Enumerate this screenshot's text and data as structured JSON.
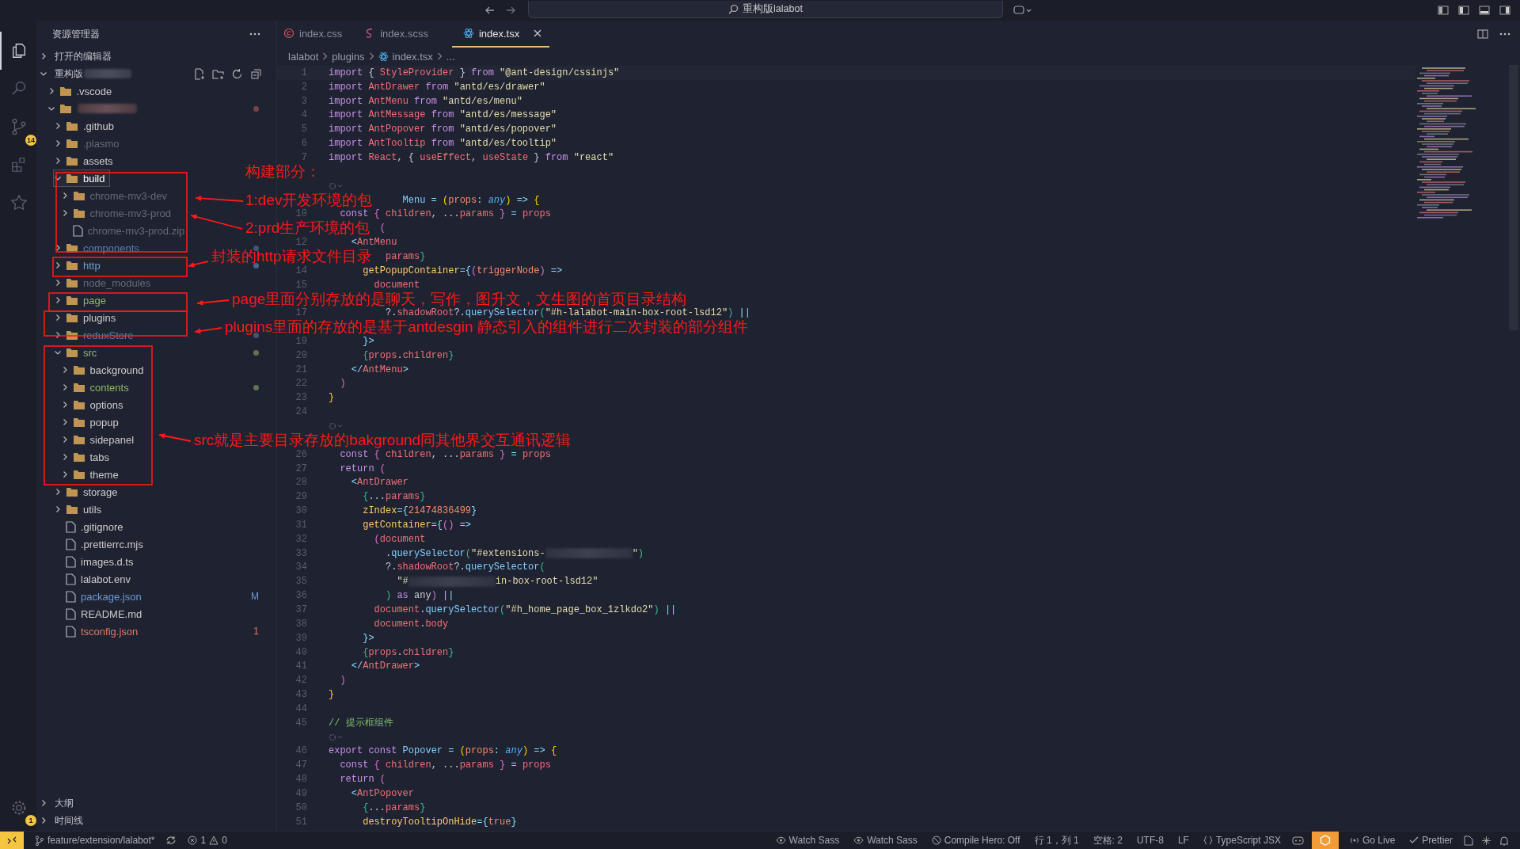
{
  "title_bar": {
    "search": "重构版lalabot"
  },
  "activity_bar": {
    "items": [
      {
        "kind": "explorer",
        "selected": true
      },
      {
        "kind": "search",
        "selected": false
      },
      {
        "kind": "scm",
        "selected": false,
        "badge": "14"
      },
      {
        "kind": "extensions",
        "selected": false
      },
      {
        "kind": "star",
        "selected": false
      }
    ],
    "account_badge": "1"
  },
  "explorer": {
    "title": "资源管理器",
    "sections": [
      {
        "label": "打开的编辑器",
        "expanded": false
      },
      {
        "label": "重构版",
        "redacted_suffix": true,
        "expanded": true,
        "items": [
          {
            "name": ".vscode",
            "kind": "folder",
            "expanded": false,
            "selected": false,
            "color": "#cccccc"
          },
          {
            "kind": "folder",
            "redacted": true,
            "expanded": true,
            "selected": false,
            "dot": true,
            "children": [
              {
                "name": ".github",
                "kind": "folder",
                "expanded": false,
                "selected": false,
                "color": "#cccccc"
              },
              {
                "name": ".plasmo",
                "kind": "folder",
                "expanded": false,
                "selected": false,
                "color": "#666b75"
              },
              {
                "name": "assets",
                "kind": "folder",
                "expanded": false,
                "selected": false,
                "color": "#cccccc"
              },
              {
                "name": "build",
                "kind": "folder",
                "expanded": true,
                "selected": true,
                "color": "#ffffff",
                "children": [
                  {
                    "name": "chrome-mv3-dev",
                    "kind": "folder",
                    "expanded": false,
                    "selected": false,
                    "color": "#666b75"
                  },
                  {
                    "name": "chrome-mv3-prod",
                    "kind": "folder",
                    "expanded": false,
                    "selected": false,
                    "color": "#666b75"
                  },
                  {
                    "name": "chrome-mv3-prod.zip",
                    "kind": "file",
                    "selected": false,
                    "color": "#666b75"
                  }
                ]
              },
              {
                "name": "components",
                "kind": "folder",
                "expanded": false,
                "selected": false,
                "color": "#5b7fae",
                "dot": true
              },
              {
                "name": "http",
                "kind": "folder",
                "expanded": false,
                "selected": false,
                "color": "#6c9bd2",
                "dot": true
              },
              {
                "name": "node_modules",
                "kind": "folder",
                "expanded": false,
                "selected": false,
                "color": "#666b75"
              },
              {
                "name": "page",
                "kind": "folder",
                "expanded": false,
                "selected": false,
                "color": "#8fb96b"
              },
              {
                "name": "plugins",
                "kind": "folder",
                "expanded": false,
                "selected": false,
                "color": "#cccccc"
              },
              {
                "name": "reduxStore",
                "kind": "folder",
                "expanded": false,
                "selected": false,
                "color": "#5b7fae",
                "dot": true
              },
              {
                "name": "src",
                "kind": "folder",
                "expanded": true,
                "selected": false,
                "color": "#8fb96b",
                "dot": true,
                "children": [
                  {
                    "name": "background",
                    "kind": "folder",
                    "expanded": false,
                    "selected": false,
                    "color": "#cccccc"
                  },
                  {
                    "name": "contents",
                    "kind": "folder",
                    "expanded": false,
                    "selected": false,
                    "color": "#8fb96b",
                    "dot": true
                  },
                  {
                    "name": "options",
                    "kind": "folder",
                    "expanded": false,
                    "selected": false,
                    "color": "#cccccc"
                  },
                  {
                    "name": "popup",
                    "kind": "folder",
                    "expanded": false,
                    "selected": false,
                    "color": "#cccccc"
                  },
                  {
                    "name": "sidepanel",
                    "kind": "folder",
                    "expanded": false,
                    "selected": false,
                    "color": "#cccccc"
                  },
                  {
                    "name": "tabs",
                    "kind": "folder",
                    "expanded": false,
                    "selected": false,
                    "color": "#cccccc"
                  },
                  {
                    "name": "theme",
                    "kind": "folder",
                    "expanded": false,
                    "selected": false,
                    "color": "#cccccc"
                  }
                ]
              },
              {
                "name": "storage",
                "kind": "folder",
                "expanded": false,
                "selected": false,
                "color": "#cccccc"
              },
              {
                "name": "utils",
                "kind": "folder",
                "expanded": false,
                "selected": false,
                "color": "#cccccc"
              },
              {
                "name": ".gitignore",
                "kind": "file",
                "selected": false,
                "color": "#cccccc"
              },
              {
                "name": ".prettierrc.mjs",
                "kind": "file",
                "selected": false,
                "color": "#cccccc"
              },
              {
                "name": "images.d.ts",
                "kind": "file",
                "selected": false,
                "color": "#cccccc"
              },
              {
                "name": "lalabot.env",
                "kind": "file",
                "selected": false,
                "color": "#cccccc"
              },
              {
                "name": "package.json",
                "kind": "file",
                "selected": false,
                "color": "#6c9bd2",
                "badge": "M"
              },
              {
                "name": "README.md",
                "kind": "file",
                "selected": false,
                "color": "#cccccc"
              },
              {
                "name": "tsconfig.json",
                "kind": "file",
                "selected": false,
                "color": "#e2786a",
                "badge": "1"
              }
            ]
          }
        ]
      }
    ],
    "bottom_sections": [
      {
        "label": "大纲",
        "expanded": false
      },
      {
        "label": "时间线",
        "expanded": false
      }
    ]
  },
  "tabs": [
    {
      "label": "index.css",
      "kind": "css",
      "selected": false
    },
    {
      "label": "index.scss",
      "kind": "scss",
      "selected": false
    },
    {
      "label": "index.tsx",
      "kind": "tsx",
      "selected": true
    }
  ],
  "breadcrumb": [
    {
      "label": "lalabot",
      "kind": "folder"
    },
    {
      "label": "plugins",
      "kind": "folder"
    },
    {
      "label": "index.tsx",
      "kind": "tsx"
    },
    {
      "label": "...",
      "kind": "more"
    }
  ],
  "code": [
    {
      "number": "1",
      "tokens": [
        {
          "text": "import",
          "kind": "keyword"
        },
        {
          "text": " { ",
          "kind": "plain"
        },
        {
          "text": "StyleProvider",
          "kind": "name"
        },
        {
          "text": " } ",
          "kind": "plain"
        },
        {
          "text": "from",
          "kind": "keyword"
        },
        {
          "text": " \"@ant-design/cssinjs\"",
          "kind": "string"
        }
      ]
    },
    {
      "number": "2",
      "tokens": [
        {
          "text": "import",
          "kind": "keyword"
        },
        {
          "text": " AntDrawer ",
          "kind": "name"
        },
        {
          "text": "from",
          "kind": "keyword"
        },
        {
          "text": " \"antd/es/drawer\"",
          "kind": "string"
        }
      ]
    },
    {
      "number": "3",
      "tokens": [
        {
          "text": "import",
          "kind": "keyword"
        },
        {
          "text": " AntMenu ",
          "kind": "name"
        },
        {
          "text": "from",
          "kind": "keyword"
        },
        {
          "text": " \"antd/es/menu\"",
          "kind": "string"
        }
      ]
    },
    {
      "number": "4",
      "tokens": [
        {
          "text": "import",
          "kind": "keyword"
        },
        {
          "text": " AntMessage ",
          "kind": "name"
        },
        {
          "text": "from",
          "kind": "keyword"
        },
        {
          "text": " \"antd/es/message\"",
          "kind": "string"
        }
      ]
    },
    {
      "number": "5",
      "tokens": [
        {
          "text": "import",
          "kind": "keyword"
        },
        {
          "text": " AntPopover ",
          "kind": "name"
        },
        {
          "text": "from",
          "kind": "keyword"
        },
        {
          "text": " \"antd/es/popover\"",
          "kind": "string"
        }
      ]
    },
    {
      "number": "6",
      "tokens": [
        {
          "text": "import",
          "kind": "keyword"
        },
        {
          "text": " AntTooltip ",
          "kind": "name"
        },
        {
          "text": "from",
          "kind": "keyword"
        },
        {
          "text": " \"antd/es/tooltip\"",
          "kind": "string"
        }
      ]
    },
    {
      "number": "7",
      "tokens": [
        {
          "text": "import",
          "kind": "keyword"
        },
        {
          "text": " React",
          "kind": "name"
        },
        {
          "text": ", { ",
          "kind": "plain"
        },
        {
          "text": "useEffect",
          "kind": "name"
        },
        {
          "text": ", ",
          "kind": "plain"
        },
        {
          "text": "useState",
          "kind": "name"
        },
        {
          "text": " } ",
          "kind": "plain"
        },
        {
          "text": "from",
          "kind": "keyword"
        },
        {
          "text": " \"react\"",
          "kind": "string"
        }
      ]
    },
    {
      "kind": "blank"
    },
    {
      "kind": "codelens"
    },
    {
      "tokens": [
        {
          "text": "             Menu",
          "kind": "function"
        },
        {
          "text": " = ",
          "kind": "operator"
        },
        {
          "text": "(",
          "kind": "bracket1"
        },
        {
          "text": "props",
          "kind": "param"
        },
        {
          "text": ": ",
          "kind": "operator"
        },
        {
          "text": "any",
          "kind": "type"
        },
        {
          "text": ")",
          "kind": "bracket1"
        },
        {
          "text": " => ",
          "kind": "operator"
        },
        {
          "text": "{",
          "kind": "bracket1"
        }
      ]
    },
    {
      "number": "10",
      "tokens": [
        {
          "text": "  const",
          "kind": "keyword"
        },
        {
          "text": " { ",
          "kind": "bracket2"
        },
        {
          "text": "children",
          "kind": "variable"
        },
        {
          "text": ", ...",
          "kind": "plain"
        },
        {
          "text": "params",
          "kind": "variable"
        },
        {
          "text": " }",
          "kind": "bracket2"
        },
        {
          "text": " = ",
          "kind": "operator"
        },
        {
          "text": "props",
          "kind": "variable"
        }
      ]
    },
    {
      "tokens": [
        {
          "text": "         (",
          "kind": "bracket2"
        }
      ]
    },
    {
      "number": "12",
      "tokens": [
        {
          "text": "    <",
          "kind": "operator"
        },
        {
          "text": "AntMenu",
          "kind": "name"
        }
      ]
    },
    {
      "tokens": [
        {
          "text": "          params",
          "kind": "variable"
        },
        {
          "text": "}",
          "kind": "bracket3"
        }
      ]
    },
    {
      "number": "14",
      "tokens": [
        {
          "text": "      getPopupContainer",
          "kind": "attribute"
        },
        {
          "text": "={",
          "kind": "operator"
        },
        {
          "text": "(",
          "kind": "bracket2"
        },
        {
          "text": "triggerNode",
          "kind": "param"
        },
        {
          "text": ")",
          "kind": "bracket2"
        },
        {
          "text": " =>",
          "kind": "operator"
        }
      ]
    },
    {
      "number": "15",
      "tokens": [
        {
          "text": "        document",
          "kind": "variable"
        }
      ]
    },
    {
      "kind": "blank"
    },
    {
      "number": "17",
      "tokens": [
        {
          "text": "          ?.",
          "kind": "plain"
        },
        {
          "text": "shadowRoot",
          "kind": "variable"
        },
        {
          "text": "?.",
          "kind": "plain"
        },
        {
          "text": "querySelector",
          "kind": "function"
        },
        {
          "text": "(",
          "kind": "bracket3"
        },
        {
          "text": "\"#h-lalabot-main-box-root-lsd12\"",
          "kind": "string"
        },
        {
          "text": ")",
          "kind": "bracket3"
        },
        {
          "text": " ||",
          "kind": "operator"
        }
      ]
    },
    {
      "kind": "blank"
    },
    {
      "number": "19",
      "tokens": [
        {
          "text": "      }>",
          "kind": "operator"
        }
      ]
    },
    {
      "number": "20",
      "tokens": [
        {
          "text": "      {",
          "kind": "bracket3"
        },
        {
          "text": "props",
          "kind": "variable"
        },
        {
          "text": ".",
          "kind": "plain"
        },
        {
          "text": "children",
          "kind": "variable"
        },
        {
          "text": "}",
          "kind": "bracket3"
        }
      ]
    },
    {
      "number": "21",
      "tokens": [
        {
          "text": "    </",
          "kind": "operator"
        },
        {
          "text": "AntMenu",
          "kind": "name"
        },
        {
          "text": ">",
          "kind": "operator"
        }
      ]
    },
    {
      "number": "22",
      "tokens": [
        {
          "text": "  )",
          "kind": "bracket2"
        }
      ]
    },
    {
      "number": "23",
      "tokens": [
        {
          "text": "}",
          "kind": "bracket1"
        }
      ]
    },
    {
      "number": "24"
    },
    {
      "kind": "codelens"
    },
    {
      "kind": "blank"
    },
    {
      "number": "26",
      "tokens": [
        {
          "text": "  const",
          "kind": "keyword"
        },
        {
          "text": " { ",
          "kind": "bracket2"
        },
        {
          "text": "children",
          "kind": "variable"
        },
        {
          "text": ", ...",
          "kind": "plain"
        },
        {
          "text": "params",
          "kind": "variable"
        },
        {
          "text": " }",
          "kind": "bracket2"
        },
        {
          "text": " = ",
          "kind": "operator"
        },
        {
          "text": "props",
          "kind": "variable"
        }
      ]
    },
    {
      "number": "27",
      "tokens": [
        {
          "text": "  return",
          "kind": "keyword"
        },
        {
          "text": " (",
          "kind": "bracket2"
        }
      ]
    },
    {
      "number": "28",
      "tokens": [
        {
          "text": "    <",
          "kind": "operator"
        },
        {
          "text": "AntDrawer",
          "kind": "name"
        }
      ]
    },
    {
      "number": "29",
      "tokens": [
        {
          "text": "      {",
          "kind": "bracket3"
        },
        {
          "text": "...",
          "kind": "plain"
        },
        {
          "text": "params",
          "kind": "variable"
        },
        {
          "text": "}",
          "kind": "bracket3"
        }
      ]
    },
    {
      "number": "30",
      "tokens": [
        {
          "text": "      zIndex",
          "kind": "attribute"
        },
        {
          "text": "={",
          "kind": "operator"
        },
        {
          "text": "21474836499",
          "kind": "number"
        },
        {
          "text": "}",
          "kind": "operator"
        }
      ]
    },
    {
      "number": "31",
      "tokens": [
        {
          "text": "      getContainer",
          "kind": "attribute"
        },
        {
          "text": "={",
          "kind": "operator"
        },
        {
          "text": "()",
          "kind": "bracket2"
        },
        {
          "text": " =>",
          "kind": "operator"
        }
      ]
    },
    {
      "number": "32",
      "tokens": [
        {
          "text": "        (",
          "kind": "bracket2"
        },
        {
          "text": "document",
          "kind": "variable"
        }
      ]
    },
    {
      "number": "33",
      "tokens": [
        {
          "text": "          .",
          "kind": "plain"
        },
        {
          "text": "querySelector",
          "kind": "function"
        },
        {
          "text": "(",
          "kind": "bracket3"
        },
        {
          "text": "\"#extensions-",
          "kind": "string"
        },
        {
          "kind": "blur"
        },
        {
          "text": "\"",
          "kind": "string"
        },
        {
          "text": ")",
          "kind": "bracket3"
        }
      ]
    },
    {
      "number": "34",
      "tokens": [
        {
          "text": "          ?.",
          "kind": "plain"
        },
        {
          "text": "shadowRoot",
          "kind": "variable"
        },
        {
          "text": "?.",
          "kind": "plain"
        },
        {
          "text": "querySelector",
          "kind": "function"
        },
        {
          "text": "(",
          "kind": "bracket3"
        }
      ]
    },
    {
      "number": "35",
      "tokens": [
        {
          "text": "            \"#",
          "kind": "string"
        },
        {
          "kind": "blur"
        },
        {
          "text": "in-box-root-lsd12\"",
          "kind": "string"
        }
      ]
    },
    {
      "number": "36",
      "tokens": [
        {
          "text": "          )",
          "kind": "bracket3"
        },
        {
          "text": " as ",
          "kind": "keyword"
        },
        {
          "text": "any",
          "kind": "plain"
        },
        {
          "text": ")",
          "kind": "bracket2"
        },
        {
          "text": " ||",
          "kind": "operator"
        }
      ]
    },
    {
      "number": "37",
      "tokens": [
        {
          "text": "        document",
          "kind": "variable"
        },
        {
          "text": ".",
          "kind": "plain"
        },
        {
          "text": "querySelector",
          "kind": "function"
        },
        {
          "text": "(",
          "kind": "bracket3"
        },
        {
          "text": "\"#h_home_page_box_1zlkdo2\"",
          "kind": "string"
        },
        {
          "text": ")",
          "kind": "bracket3"
        },
        {
          "text": " ||",
          "kind": "operator"
        }
      ]
    },
    {
      "number": "38",
      "tokens": [
        {
          "text": "        document",
          "kind": "variable"
        },
        {
          "text": ".",
          "kind": "plain"
        },
        {
          "text": "body",
          "kind": "variable"
        }
      ]
    },
    {
      "number": "39",
      "tokens": [
        {
          "text": "      }>",
          "kind": "operator"
        }
      ]
    },
    {
      "number": "40",
      "tokens": [
        {
          "text": "      {",
          "kind": "bracket3"
        },
        {
          "text": "props",
          "kind": "variable"
        },
        {
          "text": ".",
          "kind": "plain"
        },
        {
          "text": "children",
          "kind": "variable"
        },
        {
          "text": "}",
          "kind": "bracket3"
        }
      ]
    },
    {
      "number": "41",
      "tokens": [
        {
          "text": "    </",
          "kind": "operator"
        },
        {
          "text": "AntDrawer",
          "kind": "name"
        },
        {
          "text": ">",
          "kind": "operator"
        }
      ]
    },
    {
      "number": "42",
      "tokens": [
        {
          "text": "  )",
          "kind": "bracket2"
        }
      ]
    },
    {
      "number": "43",
      "tokens": [
        {
          "text": "}",
          "kind": "bracket1"
        }
      ]
    },
    {
      "number": "44"
    },
    {
      "number": "45",
      "tokens": [
        {
          "text": "// 提示框组件",
          "kind": "comment"
        }
      ]
    },
    {
      "kind": "codelens"
    },
    {
      "number": "46",
      "tokens": [
        {
          "text": "export const",
          "kind": "keyword"
        },
        {
          "text": " Popover",
          "kind": "function"
        },
        {
          "text": " = ",
          "kind": "operator"
        },
        {
          "text": "(",
          "kind": "bracket1"
        },
        {
          "text": "props",
          "kind": "param"
        },
        {
          "text": ": ",
          "kind": "operator"
        },
        {
          "text": "any",
          "kind": "type"
        },
        {
          "text": ")",
          "kind": "bracket1"
        },
        {
          "text": " => ",
          "kind": "operator"
        },
        {
          "text": "{",
          "kind": "bracket1"
        }
      ]
    },
    {
      "number": "47",
      "tokens": [
        {
          "text": "  const",
          "kind": "keyword"
        },
        {
          "text": " { ",
          "kind": "bracket2"
        },
        {
          "text": "children",
          "kind": "variable"
        },
        {
          "text": ", ...",
          "kind": "plain"
        },
        {
          "text": "params",
          "kind": "variable"
        },
        {
          "text": " }",
          "kind": "bracket2"
        },
        {
          "text": " = ",
          "kind": "operator"
        },
        {
          "text": "props",
          "kind": "variable"
        }
      ]
    },
    {
      "number": "48",
      "tokens": [
        {
          "text": "  return",
          "kind": "keyword"
        },
        {
          "text": " (",
          "kind": "bracket2"
        }
      ]
    },
    {
      "number": "49",
      "tokens": [
        {
          "text": "    <",
          "kind": "operator"
        },
        {
          "text": "AntPopover",
          "kind": "name"
        }
      ]
    },
    {
      "number": "50",
      "tokens": [
        {
          "text": "      {",
          "kind": "bracket3"
        },
        {
          "text": "...",
          "kind": "plain"
        },
        {
          "text": "params",
          "kind": "variable"
        },
        {
          "text": "}",
          "kind": "bracket3"
        }
      ]
    },
    {
      "number": "51",
      "tokens": [
        {
          "text": "      destroyTooltipOnHide",
          "kind": "attribute"
        },
        {
          "text": "={",
          "kind": "operator"
        },
        {
          "text": "true",
          "kind": "number"
        },
        {
          "text": "}",
          "kind": "operator"
        }
      ]
    }
  ],
  "annotations": [
    {
      "text": "构建部分："
    },
    {
      "text": "1:dev开发环境的包"
    },
    {
      "text": "2:prd生产环境的包"
    },
    {
      "text": "封装的http请求文件目录"
    },
    {
      "text": "page里面分别存放的是聊天，写作，图升文，文生图的首页目录结构"
    },
    {
      "text": "plugins里面的存放的是基于antdesgin 静态引入的组件进行二次封装的部分组件"
    },
    {
      "text": "src就是主要目录存放的bakground同其他界交互通讯逻辑"
    }
  ],
  "status_bar": {
    "left": [
      {
        "kind": "remote"
      },
      {
        "kind": "branch",
        "label": "feature/extension/lalabot*"
      },
      {
        "kind": "sync"
      },
      {
        "kind": "problems",
        "errors": "1",
        "warnings": "0"
      }
    ],
    "right": [
      {
        "kind": "watch",
        "label": "Watch Sass"
      },
      {
        "kind": "watch",
        "label": "Watch Sass"
      },
      {
        "kind": "compile",
        "label": "Compile Hero: Off"
      },
      {
        "kind": "text",
        "label": "行 1，列 1"
      },
      {
        "kind": "text",
        "label": "空格: 2"
      },
      {
        "kind": "text",
        "label": "UTF-8"
      },
      {
        "kind": "text",
        "label": "LF"
      },
      {
        "kind": "language",
        "label": "TypeScript JSX"
      },
      {
        "kind": "copilot"
      },
      {
        "kind": "extension"
      },
      {
        "kind": "golive",
        "label": "Go Live"
      },
      {
        "kind": "prettier",
        "label": "Prettier"
      },
      {
        "kind": "file"
      },
      {
        "kind": "sparkle"
      },
      {
        "kind": "bell"
      }
    ]
  }
}
